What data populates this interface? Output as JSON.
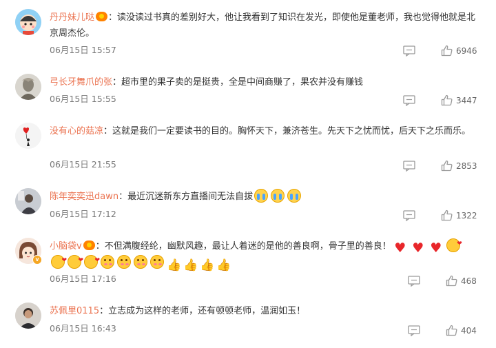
{
  "comments": [
    {
      "username": "丹丹妹儿哒",
      "separator": "：",
      "text": "读没读过书真的差别好大，他让我看到了知识在发光，即使他是董老师，我也觉得他就是北京周杰伦。",
      "time": "06月15日 15:57",
      "likes": "6946",
      "avatar_icon": "cartoon-boy-avatar"
    },
    {
      "username": "弓长牙舞爪的张",
      "separator": "：",
      "text": "超市里的果子卖的是挺贵，全是中间商赚了，果农并没有赚钱",
      "time": "06月15日 15:55",
      "likes": "3447",
      "avatar_icon": "statue-avatar"
    },
    {
      "username": "没有心的菇凉",
      "separator": "：",
      "text": "这就是我们一定要读书的目的。胸怀天下，兼济苍生。先天下之忧而忧，后天下之乐而乐。",
      "time": "06月15日 21:55",
      "likes": "2853",
      "avatar_icon": "girl-with-balloon-avatar"
    },
    {
      "username": "陈年奕奕迅dawn",
      "separator": "：",
      "text": "最近沉迷新东方直播间无法自拔",
      "time": "06月15日 17:12",
      "likes": "1322",
      "avatar_icon": "person-photo-avatar"
    },
    {
      "username": "小脑袋v",
      "separator": "：",
      "text": "不但满腹经纶，幽默风趣，最让人着迷的是他的善良啊，骨子里的善良！",
      "time": "06月15日 17:16",
      "likes": "468",
      "avatar_icon": "cartoon-girl-avatar"
    },
    {
      "username": "苏佩里0115",
      "separator": "：",
      "text": "立志成为这样的老师，还有顿顿老师，温润如玉！",
      "time": "06月15日 16:43",
      "likes": "404",
      "avatar_icon": "man-photo-avatar"
    }
  ],
  "colors": {
    "username": "#eb7350",
    "text": "#333333",
    "meta": "#777777",
    "icon": "#999999"
  }
}
